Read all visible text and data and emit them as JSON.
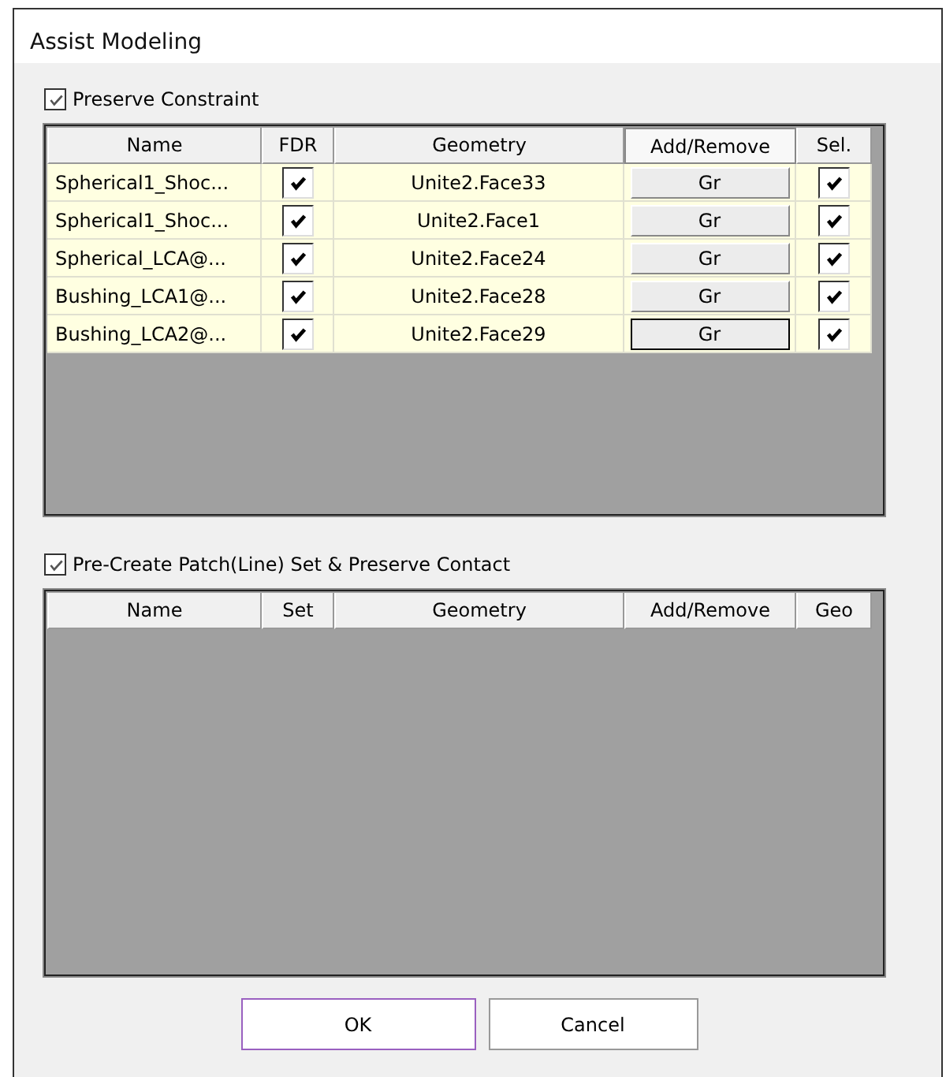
{
  "window": {
    "title": "Assist Modeling"
  },
  "constraint_section": {
    "label": "Preserve Constraint",
    "checked": true,
    "columns": [
      "Name",
      "FDR",
      "Geometry",
      "Add/Remove",
      "Sel."
    ],
    "rows": [
      {
        "name": "Spherical1_Shoc...",
        "fdr": true,
        "geometry": "Unite2.Face33",
        "button": "Gr",
        "focused": false,
        "sel": true
      },
      {
        "name": "Spherical1_Shoc...",
        "fdr": true,
        "geometry": "Unite2.Face1",
        "button": "Gr",
        "focused": false,
        "sel": true
      },
      {
        "name": "Spherical_LCA@...",
        "fdr": true,
        "geometry": "Unite2.Face24",
        "button": "Gr",
        "focused": false,
        "sel": true
      },
      {
        "name": "Bushing_LCA1@...",
        "fdr": true,
        "geometry": "Unite2.Face28",
        "button": "Gr",
        "focused": false,
        "sel": true
      },
      {
        "name": "Bushing_LCA2@...",
        "fdr": true,
        "geometry": "Unite2.Face29",
        "button": "Gr",
        "focused": true,
        "sel": true
      }
    ]
  },
  "contact_section": {
    "label": "Pre-Create Patch(Line) Set & Preserve Contact",
    "checked": true,
    "columns": [
      "Name",
      "Set",
      "Geometry",
      "Add/Remove",
      "Geo"
    ]
  },
  "buttons": [
    {
      "label": "OK",
      "default": true
    },
    {
      "label": "Cancel",
      "default": false
    }
  ]
}
